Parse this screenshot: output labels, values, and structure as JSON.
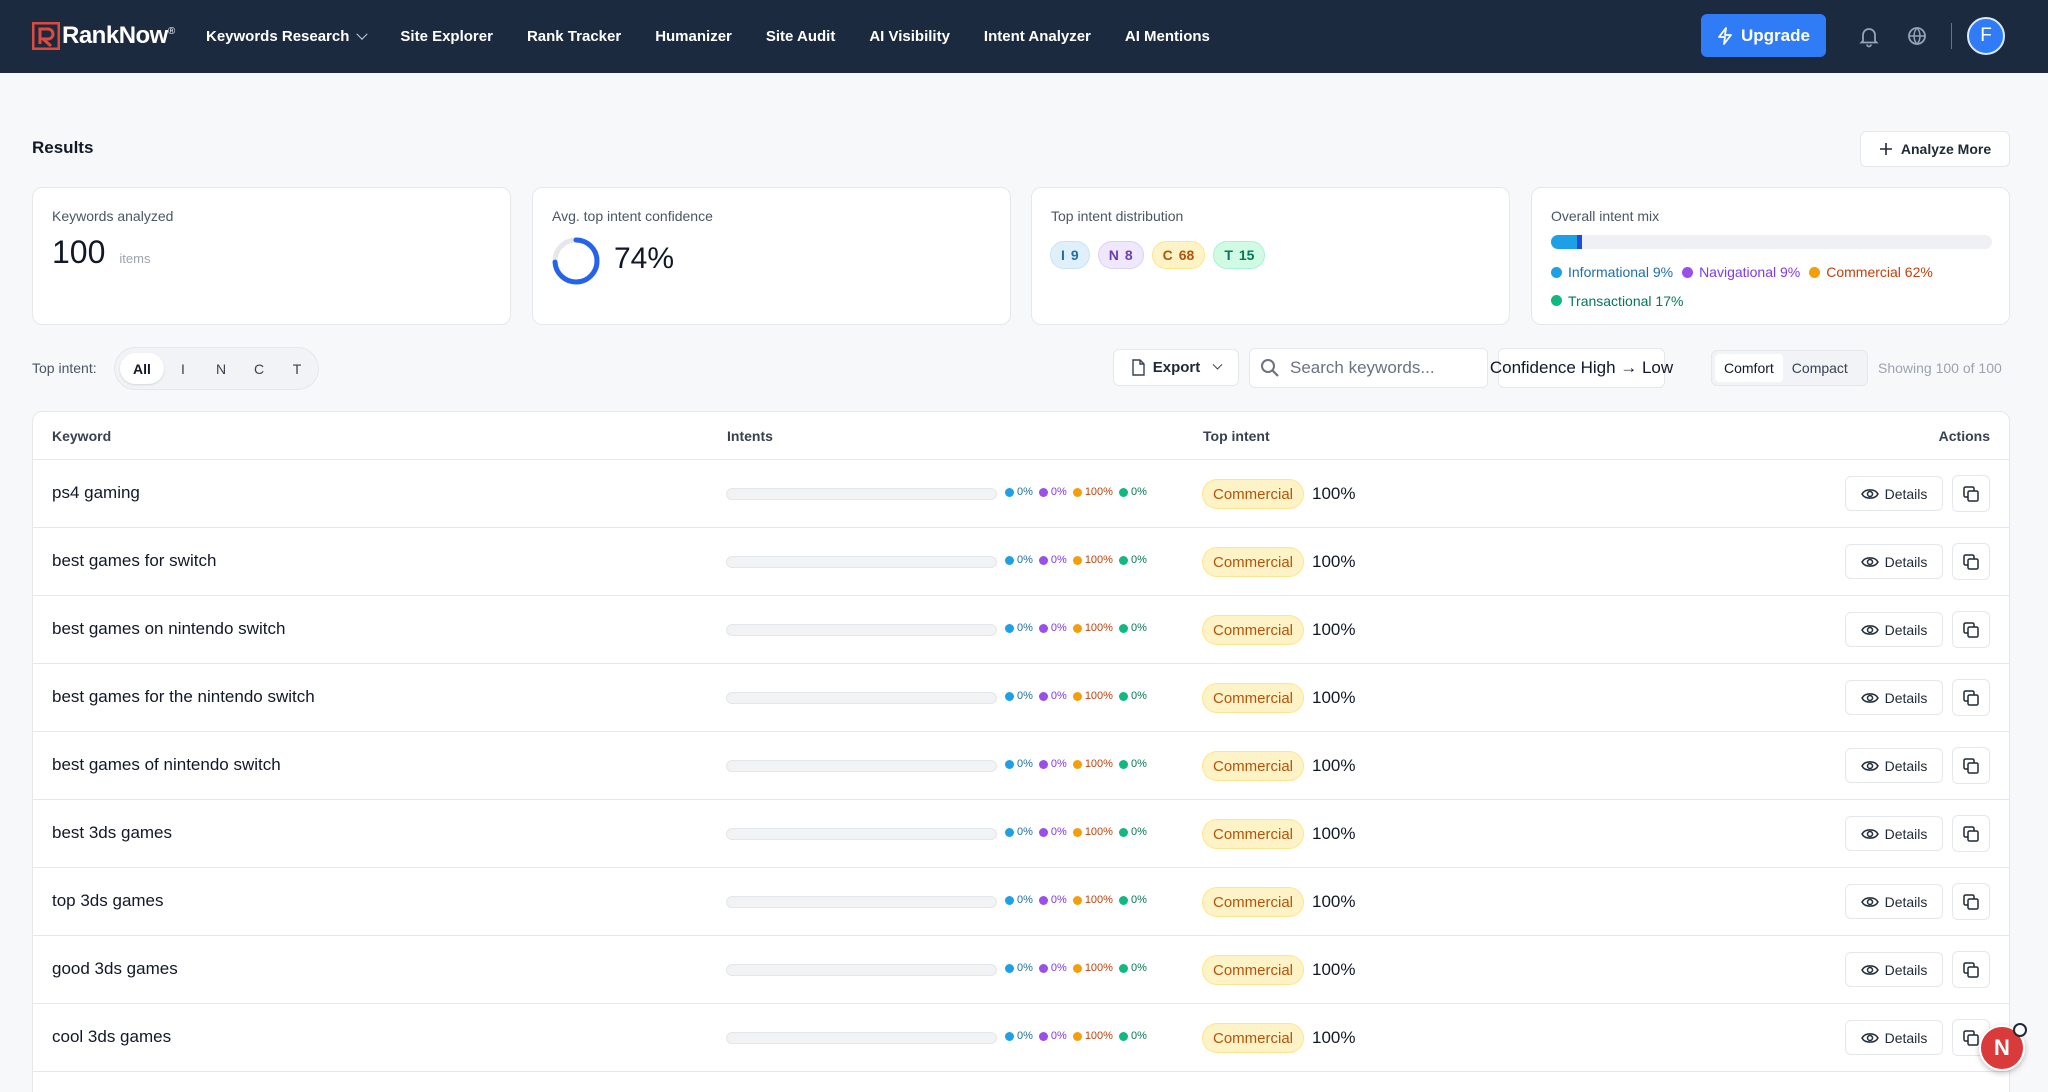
{
  "app": {
    "brand": "RankNow",
    "brand_mark": "®",
    "colors": {
      "nav_bg": "#1c2a40",
      "accent": "#2f7cf6",
      "informational": "#1ea0e6",
      "navigational": "#9b4fe8",
      "commercial": "#f59e0b",
      "transactional": "#10b981"
    }
  },
  "nav": {
    "items": [
      {
        "label": "Keywords Research",
        "has_dropdown": true
      },
      {
        "label": "Site Explorer"
      },
      {
        "label": "Rank Tracker"
      },
      {
        "label": "Humanizer"
      },
      {
        "label": "Site Audit"
      },
      {
        "label": "AI Visibility"
      },
      {
        "label": "Intent Analyzer"
      },
      {
        "label": "AI Mentions"
      }
    ],
    "upgrade_label": "Upgrade",
    "upgrade_icon": "bolt-icon",
    "icons": [
      "bell-icon",
      "globe-icon"
    ],
    "avatar_initial": "F"
  },
  "results": {
    "title": "Results",
    "analyze_more_label": "Analyze More"
  },
  "stats": {
    "keywords": {
      "label": "Keywords analyzed",
      "value": "100",
      "unit": "items"
    },
    "confidence": {
      "label": "Avg. top intent confidence",
      "value": "74%",
      "fraction": 0.74
    },
    "distribution": {
      "label": "Top intent distribution",
      "pills": [
        {
          "letter": "I",
          "count": "9"
        },
        {
          "letter": "N",
          "count": "8"
        },
        {
          "letter": "C",
          "count": "68"
        },
        {
          "letter": "T",
          "count": "15"
        }
      ]
    },
    "mix": {
      "label": "Overall intent mix",
      "bar_fill": [
        0.06,
        0.01
      ],
      "legend": [
        {
          "label": "Informational 9%"
        },
        {
          "label": "Navigational 9%"
        },
        {
          "label": "Commercial 62%"
        },
        {
          "label": "Transactional 17%"
        }
      ]
    }
  },
  "filters": {
    "label": "Top intent:",
    "options": [
      "All",
      "I",
      "N",
      "C",
      "T"
    ],
    "selected": "All",
    "export_label": "Export",
    "search_placeholder": "Search keywords...",
    "sort_label": "Confidence High → Low",
    "density_options": [
      "Comfort",
      "Compact"
    ],
    "density_selected": "Comfort",
    "showing": "Showing 100 of 100"
  },
  "table": {
    "headers": {
      "keyword": "Keyword",
      "intents": "Intents",
      "top_intent": "Top intent",
      "actions": "Actions"
    },
    "details_label": "Details",
    "rows": [
      {
        "keyword": "ps4 gaming",
        "i": "0%",
        "n": "0%",
        "c": "100%",
        "t": "0%",
        "top_intent": "Commercial",
        "top_pct": "100%"
      },
      {
        "keyword": "best games for switch",
        "i": "0%",
        "n": "0%",
        "c": "100%",
        "t": "0%",
        "top_intent": "Commercial",
        "top_pct": "100%"
      },
      {
        "keyword": "best games on nintendo switch",
        "i": "0%",
        "n": "0%",
        "c": "100%",
        "t": "0%",
        "top_intent": "Commercial",
        "top_pct": "100%"
      },
      {
        "keyword": "best games for the nintendo switch",
        "i": "0%",
        "n": "0%",
        "c": "100%",
        "t": "0%",
        "top_intent": "Commercial",
        "top_pct": "100%"
      },
      {
        "keyword": "best games of nintendo switch",
        "i": "0%",
        "n": "0%",
        "c": "100%",
        "t": "0%",
        "top_intent": "Commercial",
        "top_pct": "100%"
      },
      {
        "keyword": "best 3ds games",
        "i": "0%",
        "n": "0%",
        "c": "100%",
        "t": "0%",
        "top_intent": "Commercial",
        "top_pct": "100%"
      },
      {
        "keyword": "top 3ds games",
        "i": "0%",
        "n": "0%",
        "c": "100%",
        "t": "0%",
        "top_intent": "Commercial",
        "top_pct": "100%"
      },
      {
        "keyword": "good 3ds games",
        "i": "0%",
        "n": "0%",
        "c": "100%",
        "t": "0%",
        "top_intent": "Commercial",
        "top_pct": "100%"
      },
      {
        "keyword": "cool 3ds games",
        "i": "0%",
        "n": "0%",
        "c": "100%",
        "t": "0%",
        "top_intent": "Commercial",
        "top_pct": "100%"
      }
    ]
  },
  "fab": {
    "label": "N"
  }
}
